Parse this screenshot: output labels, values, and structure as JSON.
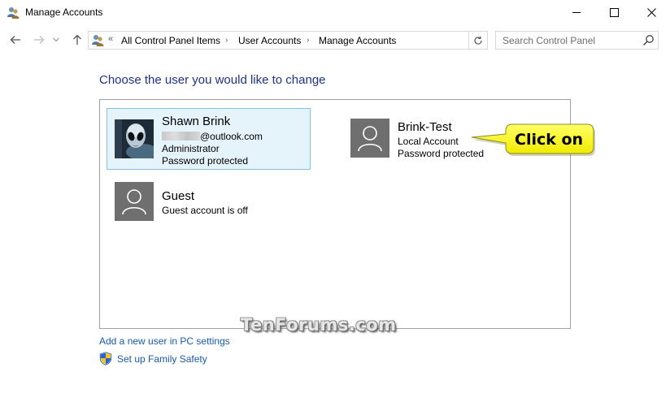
{
  "window": {
    "title": "Manage Accounts",
    "app_icon": "user-accounts-icon",
    "controls": [
      "minimize-icon",
      "maximize-icon",
      "close-icon"
    ]
  },
  "navigation": {
    "buttons": [
      "back-arrow-icon",
      "forward-arrow-icon",
      "recent-locations-icon",
      "up-arrow-icon"
    ],
    "address": {
      "overflow": "«",
      "breadcrumbs": [
        "All Control Panel Items",
        "User Accounts",
        "Manage Accounts"
      ],
      "separator": "›"
    },
    "search": {
      "placeholder": "Search Control Panel",
      "value": ""
    }
  },
  "main": {
    "heading": "Choose the user you would like to change",
    "accounts": [
      {
        "name": "Shawn Brink",
        "email_suffix": "@outlook.com",
        "type": "Administrator",
        "status": "Password protected",
        "selected": true,
        "avatar": "alien-avatar-icon"
      },
      {
        "name": "Brink-Test",
        "type": "Local Account",
        "status": "Password protected",
        "selected": false,
        "avatar": "default-user-icon"
      },
      {
        "name": "Guest",
        "status": "Guest account is off",
        "selected": false,
        "avatar": "default-user-icon"
      }
    ],
    "callout": {
      "text": "Click on",
      "color": "#ffff22"
    },
    "watermark": "TenForums.com",
    "links": {
      "add_user": "Add a new user in PC settings",
      "family_safety": "Set up Family Safety"
    }
  },
  "colors": {
    "heading": "#1e3287",
    "link": "#1a5aa8",
    "selected_bg": "#e5f3fb",
    "selected_border": "#84c1dd"
  }
}
